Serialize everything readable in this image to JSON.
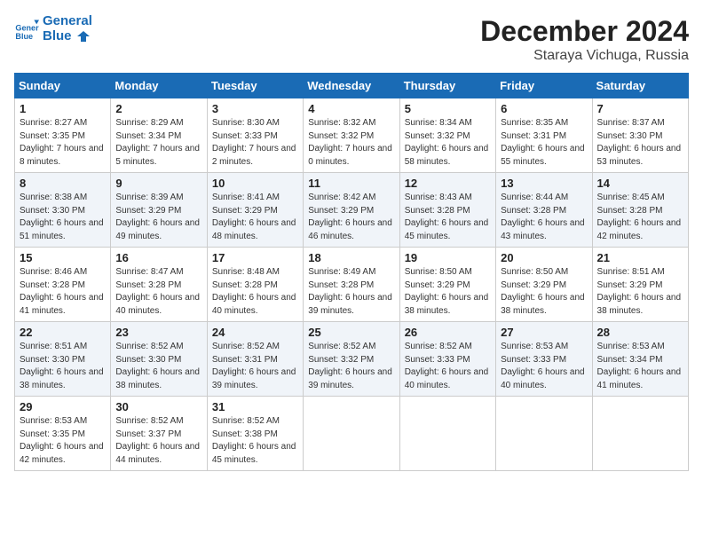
{
  "header": {
    "logo_line1": "General",
    "logo_line2": "Blue",
    "month_year": "December 2024",
    "location": "Staraya Vichuga, Russia"
  },
  "weekdays": [
    "Sunday",
    "Monday",
    "Tuesday",
    "Wednesday",
    "Thursday",
    "Friday",
    "Saturday"
  ],
  "weeks": [
    [
      {
        "day": "1",
        "sunrise": "8:27 AM",
        "sunset": "3:35 PM",
        "daylight": "7 hours and 8 minutes."
      },
      {
        "day": "2",
        "sunrise": "8:29 AM",
        "sunset": "3:34 PM",
        "daylight": "7 hours and 5 minutes."
      },
      {
        "day": "3",
        "sunrise": "8:30 AM",
        "sunset": "3:33 PM",
        "daylight": "7 hours and 2 minutes."
      },
      {
        "day": "4",
        "sunrise": "8:32 AM",
        "sunset": "3:32 PM",
        "daylight": "7 hours and 0 minutes."
      },
      {
        "day": "5",
        "sunrise": "8:34 AM",
        "sunset": "3:32 PM",
        "daylight": "6 hours and 58 minutes."
      },
      {
        "day": "6",
        "sunrise": "8:35 AM",
        "sunset": "3:31 PM",
        "daylight": "6 hours and 55 minutes."
      },
      {
        "day": "7",
        "sunrise": "8:37 AM",
        "sunset": "3:30 PM",
        "daylight": "6 hours and 53 minutes."
      }
    ],
    [
      {
        "day": "8",
        "sunrise": "8:38 AM",
        "sunset": "3:30 PM",
        "daylight": "6 hours and 51 minutes."
      },
      {
        "day": "9",
        "sunrise": "8:39 AM",
        "sunset": "3:29 PM",
        "daylight": "6 hours and 49 minutes."
      },
      {
        "day": "10",
        "sunrise": "8:41 AM",
        "sunset": "3:29 PM",
        "daylight": "6 hours and 48 minutes."
      },
      {
        "day": "11",
        "sunrise": "8:42 AM",
        "sunset": "3:29 PM",
        "daylight": "6 hours and 46 minutes."
      },
      {
        "day": "12",
        "sunrise": "8:43 AM",
        "sunset": "3:28 PM",
        "daylight": "6 hours and 45 minutes."
      },
      {
        "day": "13",
        "sunrise": "8:44 AM",
        "sunset": "3:28 PM",
        "daylight": "6 hours and 43 minutes."
      },
      {
        "day": "14",
        "sunrise": "8:45 AM",
        "sunset": "3:28 PM",
        "daylight": "6 hours and 42 minutes."
      }
    ],
    [
      {
        "day": "15",
        "sunrise": "8:46 AM",
        "sunset": "3:28 PM",
        "daylight": "6 hours and 41 minutes."
      },
      {
        "day": "16",
        "sunrise": "8:47 AM",
        "sunset": "3:28 PM",
        "daylight": "6 hours and 40 minutes."
      },
      {
        "day": "17",
        "sunrise": "8:48 AM",
        "sunset": "3:28 PM",
        "daylight": "6 hours and 40 minutes."
      },
      {
        "day": "18",
        "sunrise": "8:49 AM",
        "sunset": "3:28 PM",
        "daylight": "6 hours and 39 minutes."
      },
      {
        "day": "19",
        "sunrise": "8:50 AM",
        "sunset": "3:29 PM",
        "daylight": "6 hours and 38 minutes."
      },
      {
        "day": "20",
        "sunrise": "8:50 AM",
        "sunset": "3:29 PM",
        "daylight": "6 hours and 38 minutes."
      },
      {
        "day": "21",
        "sunrise": "8:51 AM",
        "sunset": "3:29 PM",
        "daylight": "6 hours and 38 minutes."
      }
    ],
    [
      {
        "day": "22",
        "sunrise": "8:51 AM",
        "sunset": "3:30 PM",
        "daylight": "6 hours and 38 minutes."
      },
      {
        "day": "23",
        "sunrise": "8:52 AM",
        "sunset": "3:30 PM",
        "daylight": "6 hours and 38 minutes."
      },
      {
        "day": "24",
        "sunrise": "8:52 AM",
        "sunset": "3:31 PM",
        "daylight": "6 hours and 39 minutes."
      },
      {
        "day": "25",
        "sunrise": "8:52 AM",
        "sunset": "3:32 PM",
        "daylight": "6 hours and 39 minutes."
      },
      {
        "day": "26",
        "sunrise": "8:52 AM",
        "sunset": "3:33 PM",
        "daylight": "6 hours and 40 minutes."
      },
      {
        "day": "27",
        "sunrise": "8:53 AM",
        "sunset": "3:33 PM",
        "daylight": "6 hours and 40 minutes."
      },
      {
        "day": "28",
        "sunrise": "8:53 AM",
        "sunset": "3:34 PM",
        "daylight": "6 hours and 41 minutes."
      }
    ],
    [
      {
        "day": "29",
        "sunrise": "8:53 AM",
        "sunset": "3:35 PM",
        "daylight": "6 hours and 42 minutes."
      },
      {
        "day": "30",
        "sunrise": "8:52 AM",
        "sunset": "3:37 PM",
        "daylight": "6 hours and 44 minutes."
      },
      {
        "day": "31",
        "sunrise": "8:52 AM",
        "sunset": "3:38 PM",
        "daylight": "6 hours and 45 minutes."
      },
      null,
      null,
      null,
      null
    ]
  ]
}
